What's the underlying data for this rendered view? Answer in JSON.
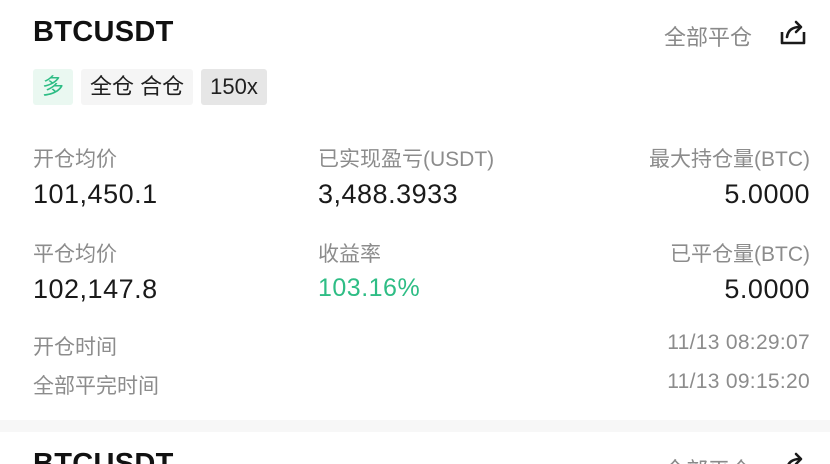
{
  "positions": [
    {
      "symbol": "BTCUSDT",
      "close_all_label": "全部平仓",
      "tags": {
        "side": "多",
        "mode": "全仓 合仓",
        "leverage": "150x"
      },
      "fields": {
        "open_avg_price_label": "开仓均价",
        "open_avg_price": "101,450.1",
        "realized_pnl_label": "已实现盈亏(USDT)",
        "realized_pnl": "3,488.3933",
        "max_position_label": "最大持仓量(BTC)",
        "max_position": "5.0000",
        "close_avg_price_label": "平仓均价",
        "close_avg_price": "102,147.8",
        "roi_label": "收益率",
        "roi": "103.16%",
        "closed_amount_label": "已平仓量(BTC)",
        "closed_amount": "5.0000"
      },
      "open_time_label": "开仓时间",
      "open_time": "11/13 08:29:07",
      "close_time_label": "全部平完时间",
      "close_time": "11/13 09:15:20"
    },
    {
      "symbol": "BTCUSDT",
      "close_all_label": "全部平仓"
    }
  ],
  "colors": {
    "profit_green": "#2ebd85",
    "muted_text": "#8c8c8c",
    "primary_text": "#1a1a1a"
  },
  "icons": {
    "share": "share-icon"
  }
}
